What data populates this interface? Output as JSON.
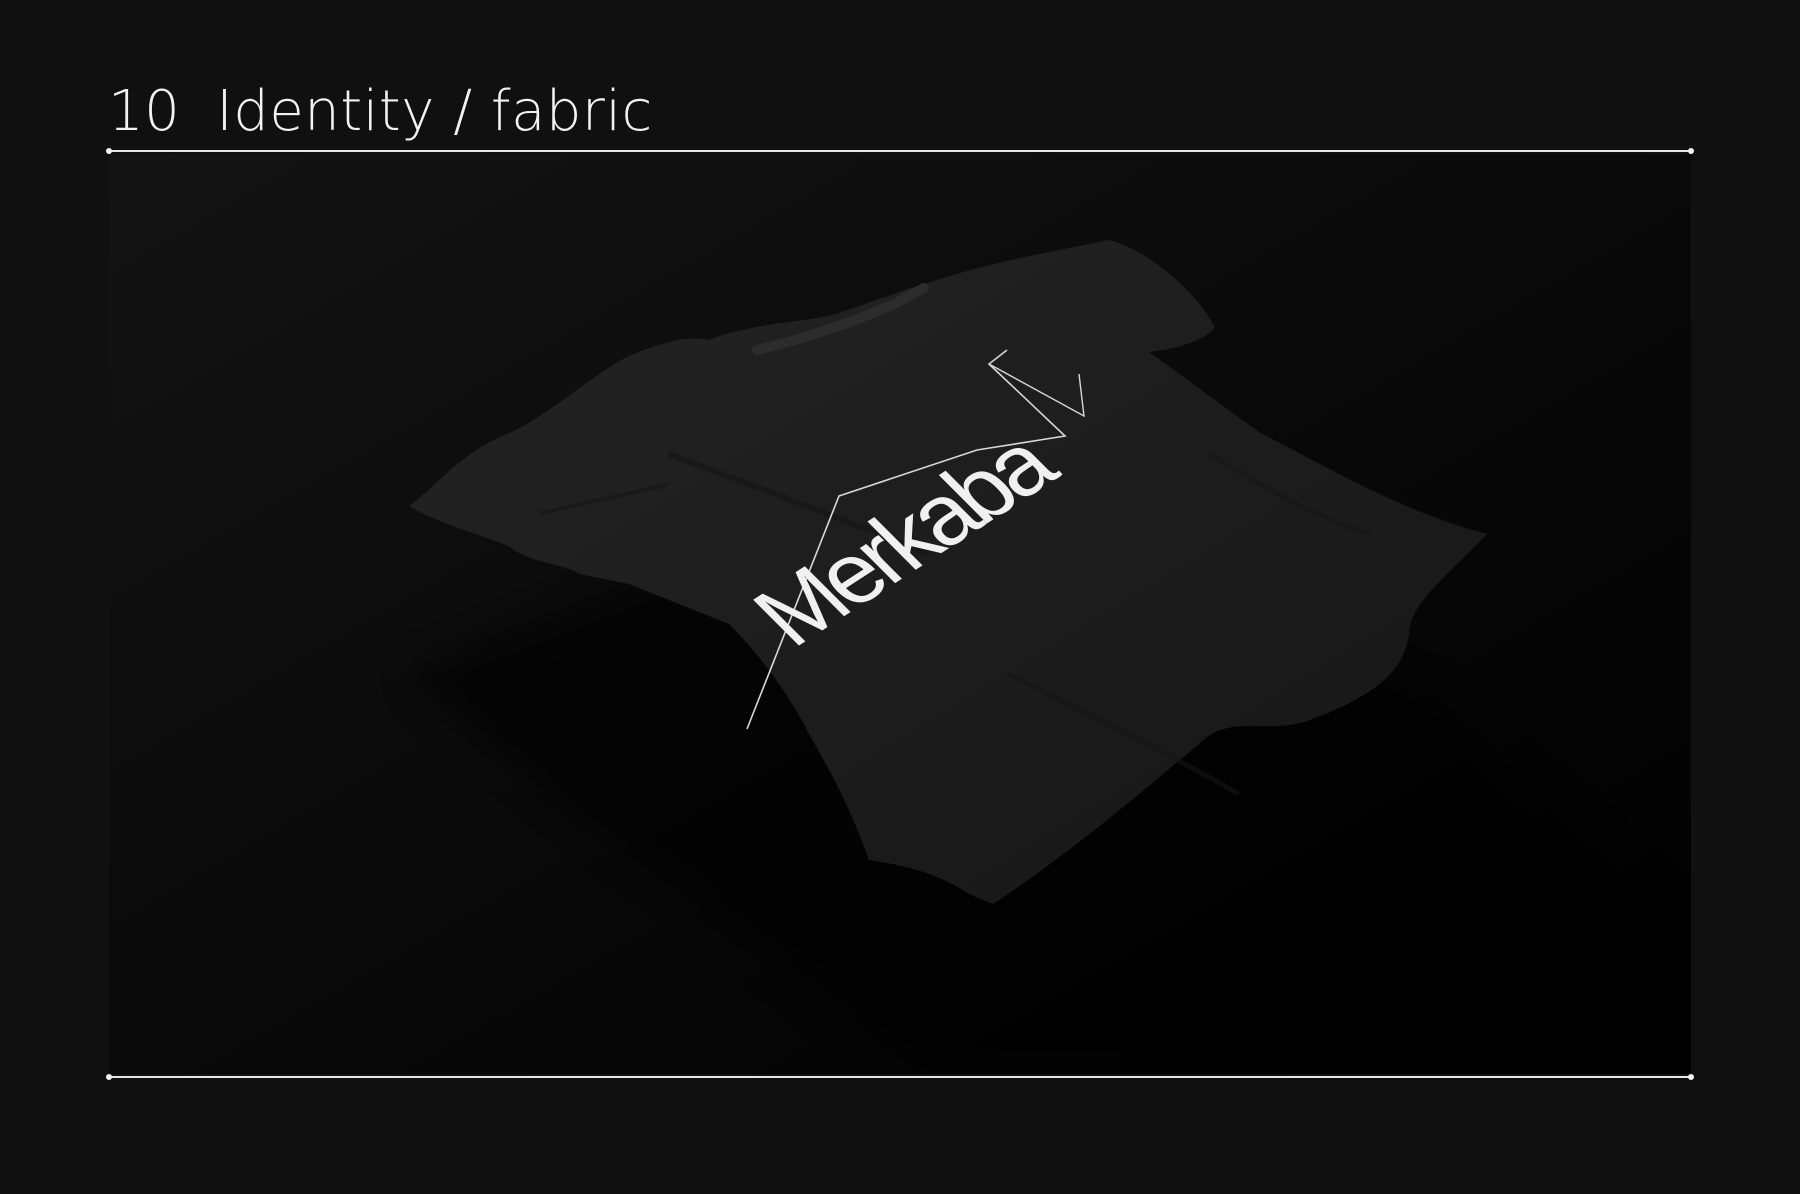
{
  "section": {
    "number": "10",
    "title": "Identity / fabric"
  },
  "mockup": {
    "brand_text": "Merkaba",
    "colors": {
      "page_background": "#101010",
      "rule": "#e6e6e6",
      "shirt": "#1b1b1b",
      "print": "#f0f0f0"
    }
  }
}
